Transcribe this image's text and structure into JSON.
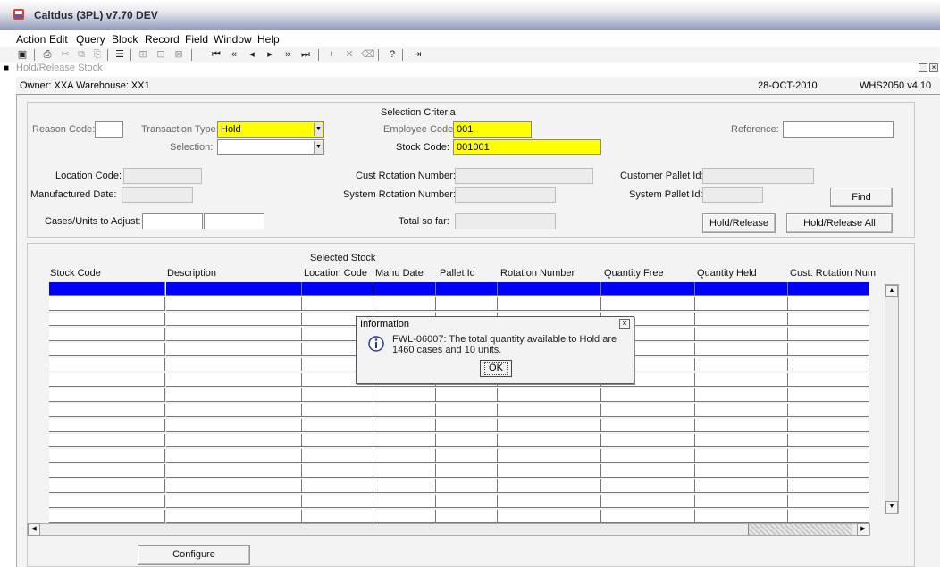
{
  "window": {
    "title": "Caltdus (3PL) v7.70 DEV"
  },
  "menu": [
    "Action",
    "Edit",
    "Query",
    "Block",
    "Record",
    "Field",
    "Window",
    "Help"
  ],
  "toolbar_icons": [
    "save-icon",
    "print-icon",
    "cut-icon",
    "copy-icon",
    "paste-icon",
    "list-icon",
    "enter-query-icon",
    "execute-query-icon",
    "cancel-query-icon",
    "first-record-icon",
    "previous-block-icon",
    "previous-record-icon",
    "next-record-icon",
    "next-block-icon",
    "last-record-icon",
    "insert-record-icon",
    "delete-record-icon",
    "clear-record-icon",
    "help-icon",
    "exit-icon"
  ],
  "form": {
    "title": "Hold/Release Stock",
    "owner_text": "Owner: XXA   Warehouse: XX1",
    "date": "28-OCT-2010",
    "form_code": "WHS2050 v4.10"
  },
  "selection": {
    "section_title": "Selection Criteria",
    "reason_code_label": "Reason Code:",
    "reason_code_value": "",
    "transaction_type_label": "Transaction Type:",
    "transaction_type_value": "Hold",
    "selection_label": "Selection:",
    "selection_value": "",
    "employee_code_label": "Employee Code:",
    "employee_code_value": "001",
    "stock_code_label": "Stock Code:",
    "stock_code_value": "001001",
    "reference_label": "Reference:",
    "reference_value": "",
    "location_code_label": "Location Code:",
    "manufactured_date_label": "Manufactured Date:",
    "cust_rotation_label": "Cust Rotation Number:",
    "system_rotation_label": "System Rotation Number:",
    "customer_pallet_label": "Customer Pallet Id:",
    "system_pallet_label": "System Pallet Id:",
    "find_label": "Find",
    "cases_units_label": "Cases/Units to Adjust:",
    "total_so_far_label": "Total so far:",
    "hold_release_label": "Hold/Release",
    "hold_release_all_label": "Hold/Release All"
  },
  "grid": {
    "section_title": "Selected Stock",
    "columns": [
      "Stock Code",
      "Description",
      "Location Code",
      "Manu Date",
      "Pallet Id",
      "Rotation Number",
      "Quantity Free",
      "Quantity Held",
      "Cust. Rotation Num"
    ],
    "row_count": 16,
    "selected_row_color": "#0000ff"
  },
  "configure_label": "Configure",
  "dialog": {
    "title": "Information",
    "message": "FWL-06007: The total quantity available to Hold are 1460 cases and 10 units.",
    "ok_label": "OK"
  }
}
